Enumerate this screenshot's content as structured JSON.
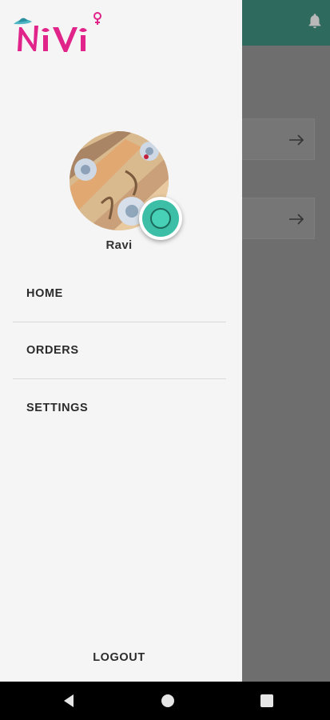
{
  "app": {
    "name": "NiVi"
  },
  "colors": {
    "brand_pink": "#e0248a",
    "accent_teal": "#3dbfa7",
    "appbar_teal": "#2f6a5e"
  },
  "drawer": {
    "user_name": "Ravi",
    "menu": [
      {
        "label": "HOME"
      },
      {
        "label": "ORDERS"
      },
      {
        "label": "SETTINGS"
      }
    ],
    "logout_label": "LOGOUT"
  },
  "icons": {
    "bell": "bell-icon",
    "arrow": "arrow-right-icon",
    "camera": "camera-icon",
    "back": "back-triangle-icon",
    "home": "home-circle-icon",
    "recent": "recent-square-icon"
  }
}
